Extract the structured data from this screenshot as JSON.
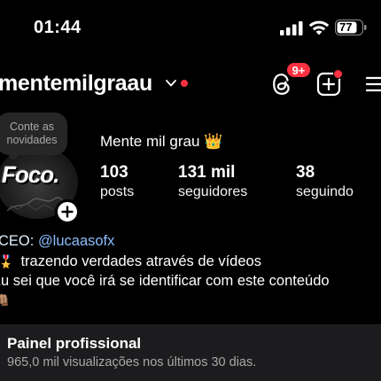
{
  "status_bar": {
    "time": "01:44",
    "battery": "77"
  },
  "header": {
    "username": "mentemilgraau",
    "threads_badge": "9+"
  },
  "profile": {
    "note": "Conte as novidades",
    "avatar_text": "Foco.",
    "display_name": "Mente mil grau 👑",
    "stats": [
      {
        "value": "103",
        "label": "posts"
      },
      {
        "value": "131 mil",
        "label": "seguidores"
      },
      {
        "value": "38",
        "label": "seguindo"
      }
    ]
  },
  "bio": {
    "ceo_prefix": "CEO: ",
    "ceo_handle": "@lucaasofx",
    "line2_emoji": "🎖️",
    "line2": "trazendo verdades através de vídeos",
    "line3": "Eu sei que você irá se identificar com este conteúdo",
    "line4_emoji": "👊🏽"
  },
  "professional_panel": {
    "title": "Painel profissional",
    "subtitle": "965,0 mil visualizações nos últimos 30 dias."
  },
  "colors": {
    "accent_red": "#ff3040",
    "link": "#8bbdff",
    "panel_bg": "#1c1c1e"
  }
}
